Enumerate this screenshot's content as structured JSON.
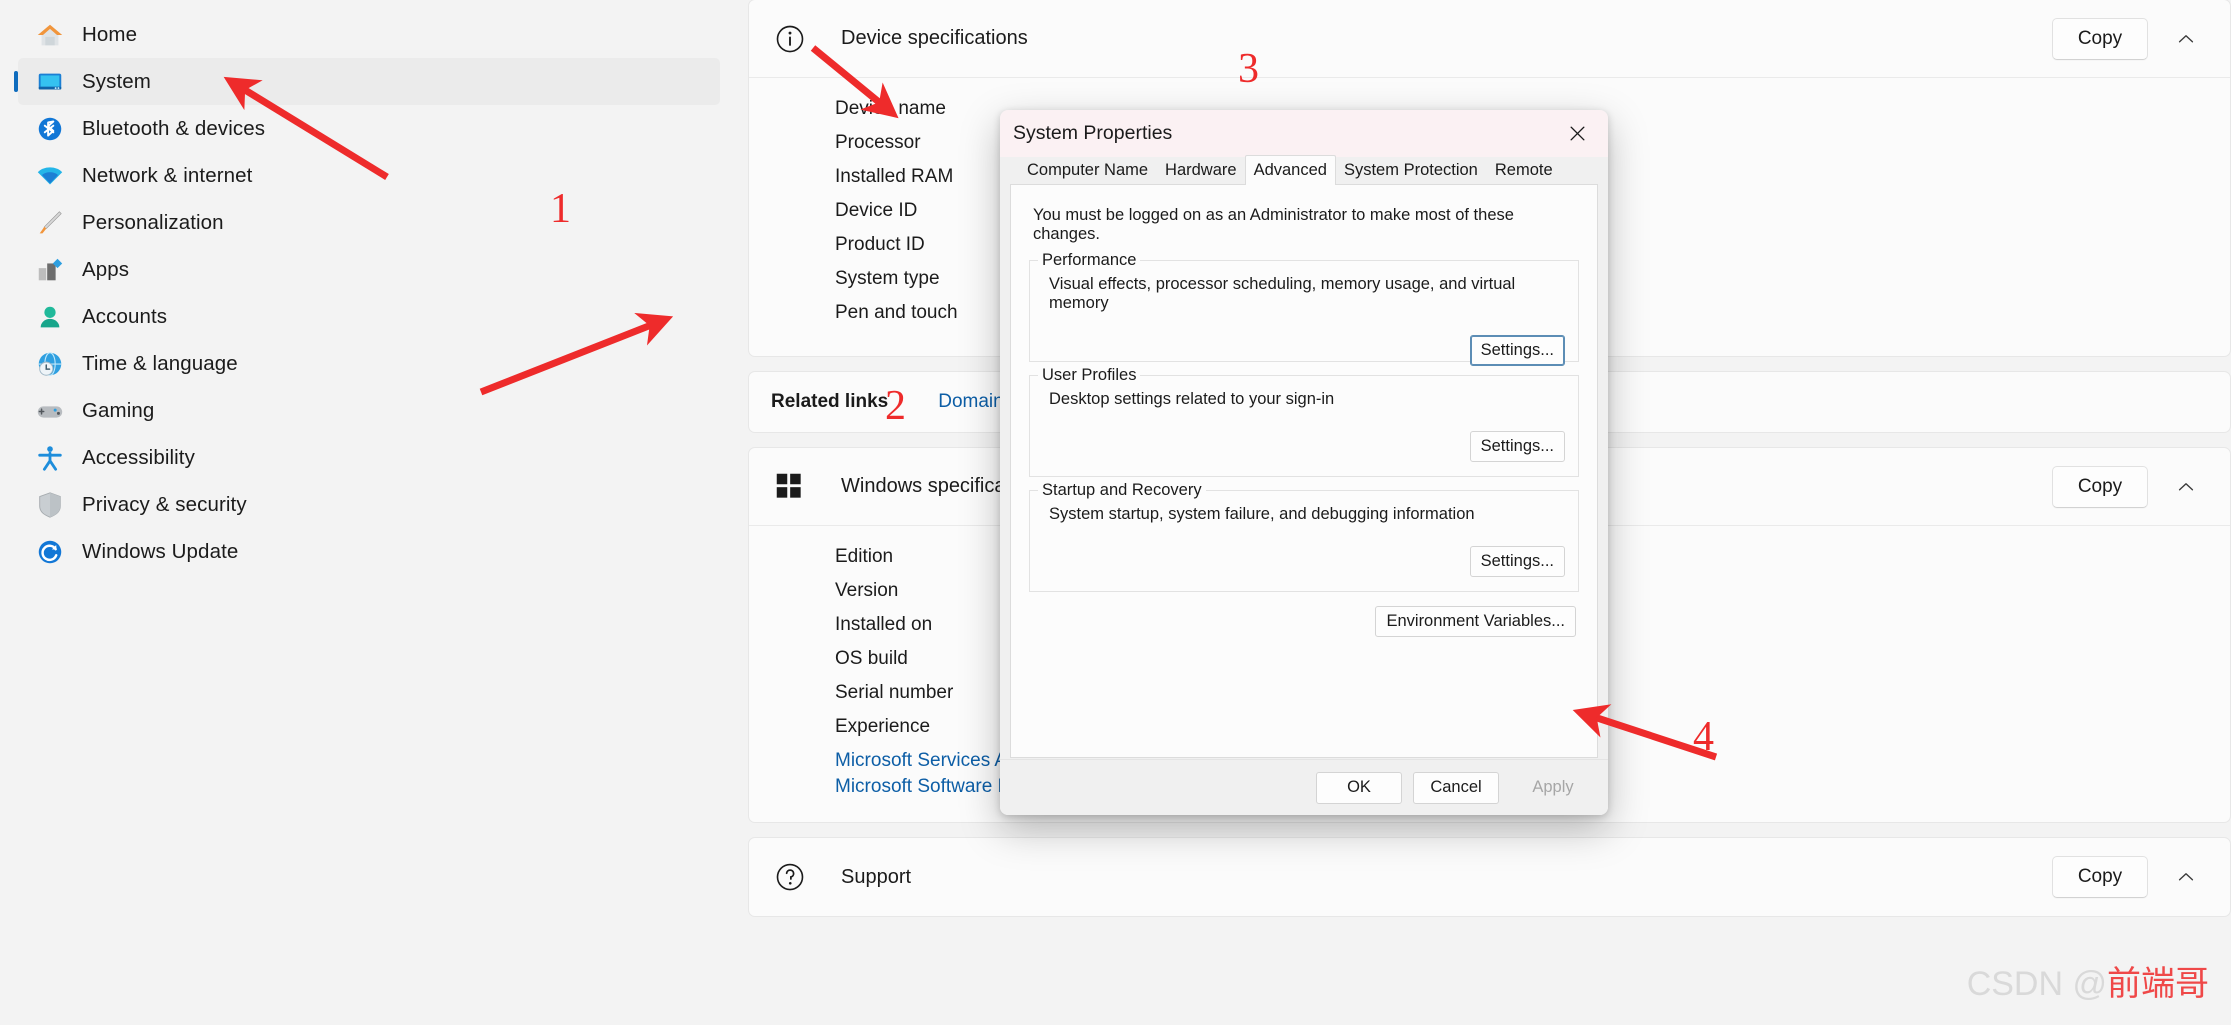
{
  "sidebar": {
    "items": [
      {
        "label": "Home",
        "icon": "home-icon",
        "selected": false
      },
      {
        "label": "System",
        "icon": "system-monitor-icon",
        "selected": true
      },
      {
        "label": "Bluetooth & devices",
        "icon": "bluetooth-icon",
        "selected": false
      },
      {
        "label": "Network & internet",
        "icon": "wifi-icon",
        "selected": false
      },
      {
        "label": "Personalization",
        "icon": "paintbrush-icon",
        "selected": false
      },
      {
        "label": "Apps",
        "icon": "apps-icon",
        "selected": false
      },
      {
        "label": "Accounts",
        "icon": "person-icon",
        "selected": false
      },
      {
        "label": "Time & language",
        "icon": "clock-globe-icon",
        "selected": false
      },
      {
        "label": "Gaming",
        "icon": "gamepad-icon",
        "selected": false
      },
      {
        "label": "Accessibility",
        "icon": "accessibility-icon",
        "selected": false
      },
      {
        "label": "Privacy & security",
        "icon": "shield-icon",
        "selected": false
      },
      {
        "label": "Windows Update",
        "icon": "update-sync-icon",
        "selected": false
      }
    ]
  },
  "content": {
    "device_specifications": {
      "title": "Device specifications",
      "icon": "info-circle-icon",
      "copy_label": "Copy",
      "collapse_icon": "chevron-up-icon",
      "rows": [
        {
          "key": "Device name",
          "value": ""
        },
        {
          "key": "Processor",
          "value": ""
        },
        {
          "key": "Installed RAM",
          "value": ""
        },
        {
          "key": "Device ID",
          "value": ""
        },
        {
          "key": "Product ID",
          "value": ""
        },
        {
          "key": "System type",
          "value": ""
        },
        {
          "key": "Pen and touch",
          "value": ""
        }
      ]
    },
    "related_links": {
      "title": "Related links",
      "link": "Domain"
    },
    "windows_specifications": {
      "title": "Windows specifications",
      "icon": "windows-logo-icon",
      "copy_label": "Copy",
      "collapse_icon": "chevron-up-icon",
      "rows": [
        {
          "key": "Edition",
          "value": ""
        },
        {
          "key": "Version",
          "value": ""
        },
        {
          "key": "Installed on",
          "value": ""
        },
        {
          "key": "OS build",
          "value": ""
        },
        {
          "key": "Serial number",
          "value": ""
        },
        {
          "key": "Experience",
          "value": ""
        }
      ],
      "links": [
        "Microsoft Services Agreement",
        "Microsoft Software License Terms"
      ]
    },
    "support": {
      "title": "Support",
      "icon": "question-circle-icon",
      "copy_label": "Copy",
      "collapse_icon": "chevron-up-icon"
    }
  },
  "dialog": {
    "title": "System Properties",
    "close_icon": "close-icon",
    "tabs": [
      {
        "label": "Computer Name",
        "active": false
      },
      {
        "label": "Hardware",
        "active": false
      },
      {
        "label": "Advanced",
        "active": true
      },
      {
        "label": "System Protection",
        "active": false
      },
      {
        "label": "Remote",
        "active": false
      }
    ],
    "admin_note": "You must be logged on as an Administrator to make most of these changes.",
    "groups": [
      {
        "legend": "Performance",
        "description": "Visual effects, processor scheduling, memory usage, and virtual memory",
        "button": "Settings...",
        "button_focused": true
      },
      {
        "legend": "User Profiles",
        "description": "Desktop settings related to your sign-in",
        "button": "Settings...",
        "button_focused": false
      },
      {
        "legend": "Startup and Recovery",
        "description": "System startup, system failure, and debugging information",
        "button": "Settings...",
        "button_focused": false
      }
    ],
    "environment_variables_label": "Environment Variables...",
    "footer": {
      "ok": "OK",
      "cancel": "Cancel",
      "apply": "Apply",
      "apply_disabled": true
    }
  },
  "annotations": {
    "color": "#ee2b2b",
    "markers": [
      {
        "number": "1",
        "target": "sidebar-item-system"
      },
      {
        "number": "2",
        "target": "related-links-domain"
      },
      {
        "number": "3",
        "target": "dialog-tab-advanced"
      },
      {
        "number": "4",
        "target": "environment-variables-button"
      }
    ]
  },
  "watermark": {
    "prefix": "CSDN @",
    "name": "前端哥"
  }
}
